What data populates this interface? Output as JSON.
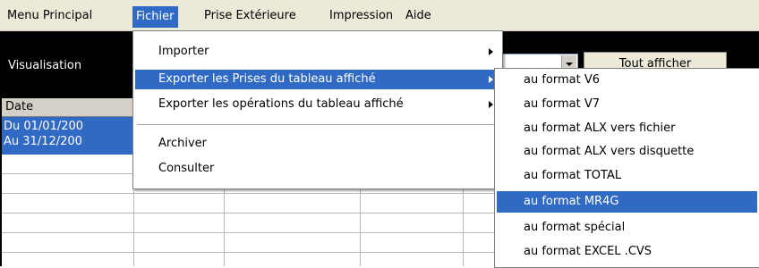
{
  "menubar": {
    "items": [
      "Menu Principal",
      "Fichier",
      "Prise Extérieure",
      "Impression",
      "Aide"
    ]
  },
  "view": {
    "label": "Visualisation",
    "button_label": "Tout afficher"
  },
  "grid": {
    "header_date": "Date",
    "rows": [
      "Du 01/01/200",
      "Au 31/12/200"
    ]
  },
  "fichier_menu": {
    "items": [
      "Importer",
      "Exporter les Prises du tableau affiché",
      "Exporter les opérations du tableau affiché",
      "Archiver",
      "Consulter"
    ]
  },
  "export_submenu": {
    "items": [
      "au format V6",
      "au format V7",
      "au format ALX vers fichier",
      "au format ALX vers disquette",
      "au format TOTAL",
      "au format MR4G",
      "au format spécial",
      "au format EXCEL .CVS"
    ],
    "highlighted": "au format MR4G"
  },
  "colors": {
    "highlight": "#316AC5",
    "menubar": "#ECE9D8"
  }
}
